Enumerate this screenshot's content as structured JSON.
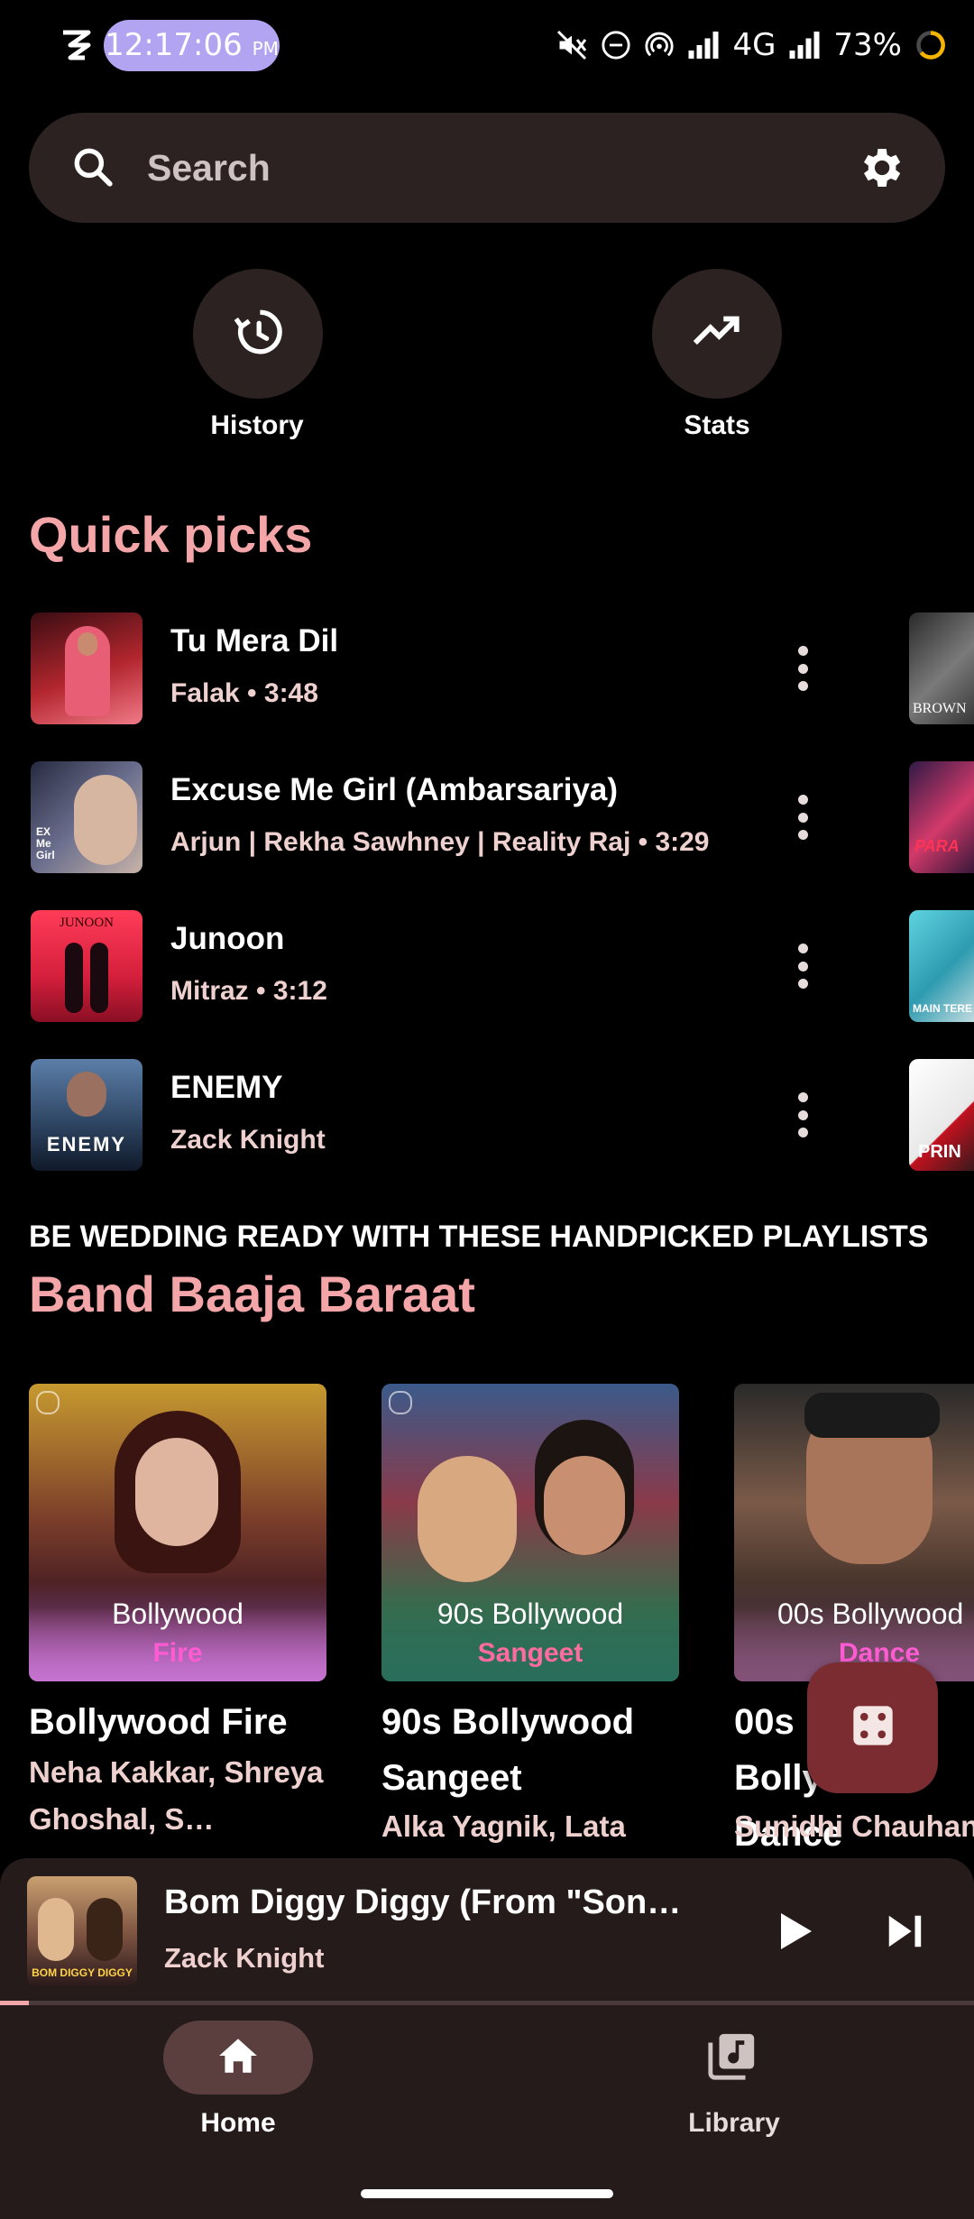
{
  "status_bar": {
    "time": "12:17:06",
    "ampm": "PM",
    "network": "4G",
    "battery": "73%",
    "icons": [
      "app-logo-icon",
      "mute-icon",
      "dnd-icon",
      "hotspot-icon",
      "signal-icon",
      "signal-icon-2",
      "battery-ring-icon"
    ]
  },
  "search": {
    "placeholder": "Search"
  },
  "shortcuts": [
    {
      "label": "History",
      "icon": "history-icon"
    },
    {
      "label": "Stats",
      "icon": "trending-icon"
    }
  ],
  "quick_picks": {
    "title": "Quick picks",
    "items": [
      {
        "title": "Tu Mera Dil",
        "subtitle": "Falak • 3:48",
        "art_color": "#b3262e"
      },
      {
        "title": "Excuse Me Girl (Ambarsariya)",
        "subtitle": "Arjun | Rekha Sawhney | Reality Raj • 3:29",
        "art_color": "#6b6f8e"
      },
      {
        "title": "Junoon",
        "subtitle": "Mitraz • 3:12",
        "art_color": "#d41f3c"
      },
      {
        "title": "ENEMY",
        "subtitle": "Zack Knight",
        "art_color": "#304866"
      }
    ],
    "peek_labels": [
      "BROWN",
      "PARA",
      "MAIN TERE",
      "PRIN"
    ]
  },
  "playlists": {
    "eyebrow": "BE WEDDING READY WITH THESE HANDPICKED PLAYLISTS",
    "title": "Band Baaja Baraat",
    "cards": [
      {
        "overlay_line1": "Bollywood",
        "overlay_line2": "Fire",
        "title": "Bollywood Fire",
        "subtitle": "Neha Kakkar, Shreya Ghoshal, S…"
      },
      {
        "overlay_line1": "90s Bollywood",
        "overlay_line2": "Sangeet",
        "title": "90s Bollywood Sangeet",
        "subtitle": "Alka Yagnik, Lata"
      },
      {
        "overlay_line1": "00s Bollywood",
        "overlay_line2": "Dance",
        "title": "00s Bollywood Dance",
        "subtitle": "Sunidhi Chauhan"
      }
    ]
  },
  "fab": {
    "icon": "dice-icon"
  },
  "now_playing": {
    "title": "Bom Diggy Diggy (From \"Son…",
    "artist": "Zack Knight",
    "art_caption": "BOM DIGGY DIGGY",
    "progress": 0.03
  },
  "bottom_nav": {
    "items": [
      {
        "label": "Home",
        "icon": "home-icon",
        "selected": true
      },
      {
        "label": "Library",
        "icon": "library-icon",
        "selected": false
      }
    ]
  }
}
